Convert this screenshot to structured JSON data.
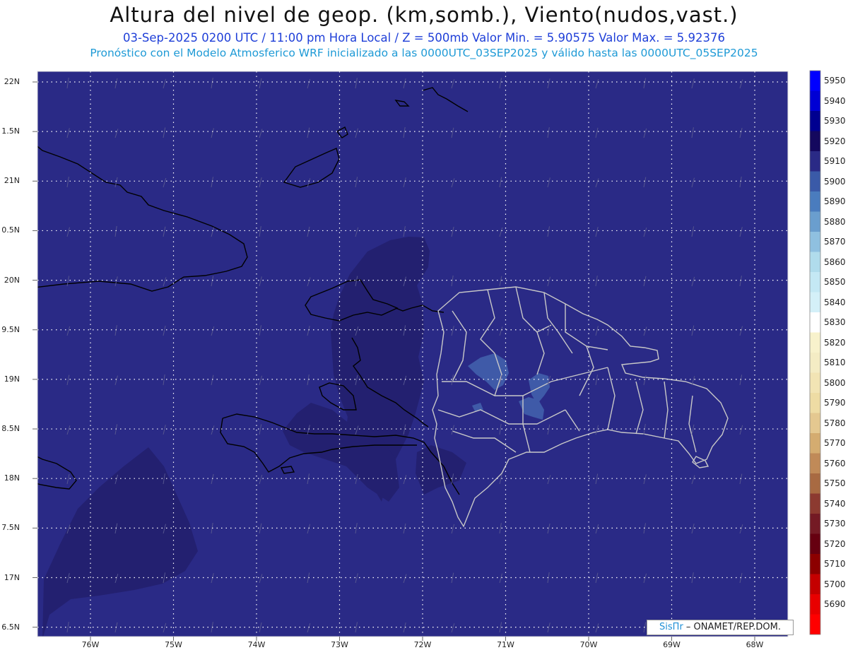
{
  "header": {
    "title": "Altura del nivel de geop. (km,somb.), Viento(nudos,vast.)",
    "subtitle": "03-Sep-2025  0200 UTC / 11:00 pm Hora Local / Z = 500mb    Valor Min. = 5.90575  Valor Max. = 5.92376",
    "model_line": "Pronóstico con el Modelo Atmosferico WRF inicializado a las 0000UTC_03SEP2025 y válido hasta las  0000UTC_05SEP2025"
  },
  "map": {
    "lon_range": [
      -76.6,
      -67.6
    ],
    "lat_range": [
      16.4,
      22.1
    ],
    "lat_labels": [
      "22N",
      "1.5N",
      "21N",
      "0.5N",
      "20N",
      "9.5N",
      "19N",
      "8.5N",
      "18N",
      "7.5N",
      "17N",
      "6.5N"
    ],
    "lon_labels": [
      "76W",
      "75W",
      "74W",
      "73W",
      "72W",
      "71W",
      "70W",
      "69W",
      "68W"
    ],
    "base_fill_color": "#2a2a86",
    "elevated_fill_color": "#232070",
    "highlight_fill_color": "#3f5aa8",
    "coast_color": "#000000",
    "province_border_color": "#c8c8c8",
    "grid_color": "#ffffff"
  },
  "colorbar": {
    "units_note": "",
    "levels": [
      {
        "label": "5950",
        "color": "#0000ff"
      },
      {
        "label": "5940",
        "color": "#0000d4"
      },
      {
        "label": "5930",
        "color": "#000090"
      },
      {
        "label": "5920",
        "color": "#14085e"
      },
      {
        "label": "5910",
        "color": "#2a2a86"
      },
      {
        "label": "5900",
        "color": "#3a5aa8"
      },
      {
        "label": "5890",
        "color": "#4a7cbe"
      },
      {
        "label": "5880",
        "color": "#6a9ece"
      },
      {
        "label": "5870",
        "color": "#8fc0e0"
      },
      {
        "label": "5860",
        "color": "#b0dcec"
      },
      {
        "label": "5850",
        "color": "#c4e8f4"
      },
      {
        "label": "5840",
        "color": "#d4f0f8"
      },
      {
        "label": "5830",
        "color": "#ffffff"
      },
      {
        "label": "5820",
        "color": "#f8f2cc"
      },
      {
        "label": "5810",
        "color": "#f4ecc4"
      },
      {
        "label": "5800",
        "color": "#f2e4b4"
      },
      {
        "label": "5790",
        "color": "#eedca4"
      },
      {
        "label": "5780",
        "color": "#e4c890"
      },
      {
        "label": "5770",
        "color": "#d4ac70"
      },
      {
        "label": "5760",
        "color": "#c08a58"
      },
      {
        "label": "5750",
        "color": "#a86a42"
      },
      {
        "label": "5740",
        "color": "#8c3a30"
      },
      {
        "label": "5730",
        "color": "#741a24"
      },
      {
        "label": "5720",
        "color": "#660010"
      },
      {
        "label": "5710",
        "color": "#8c0000"
      },
      {
        "label": "5700",
        "color": "#c40000"
      },
      {
        "label": "5690",
        "color": "#e80000"
      },
      {
        "label": "",
        "color": "#ff0000"
      }
    ]
  },
  "credit": {
    "brand": "SisПr",
    "org": " – ONAMET/REP.DOM."
  }
}
